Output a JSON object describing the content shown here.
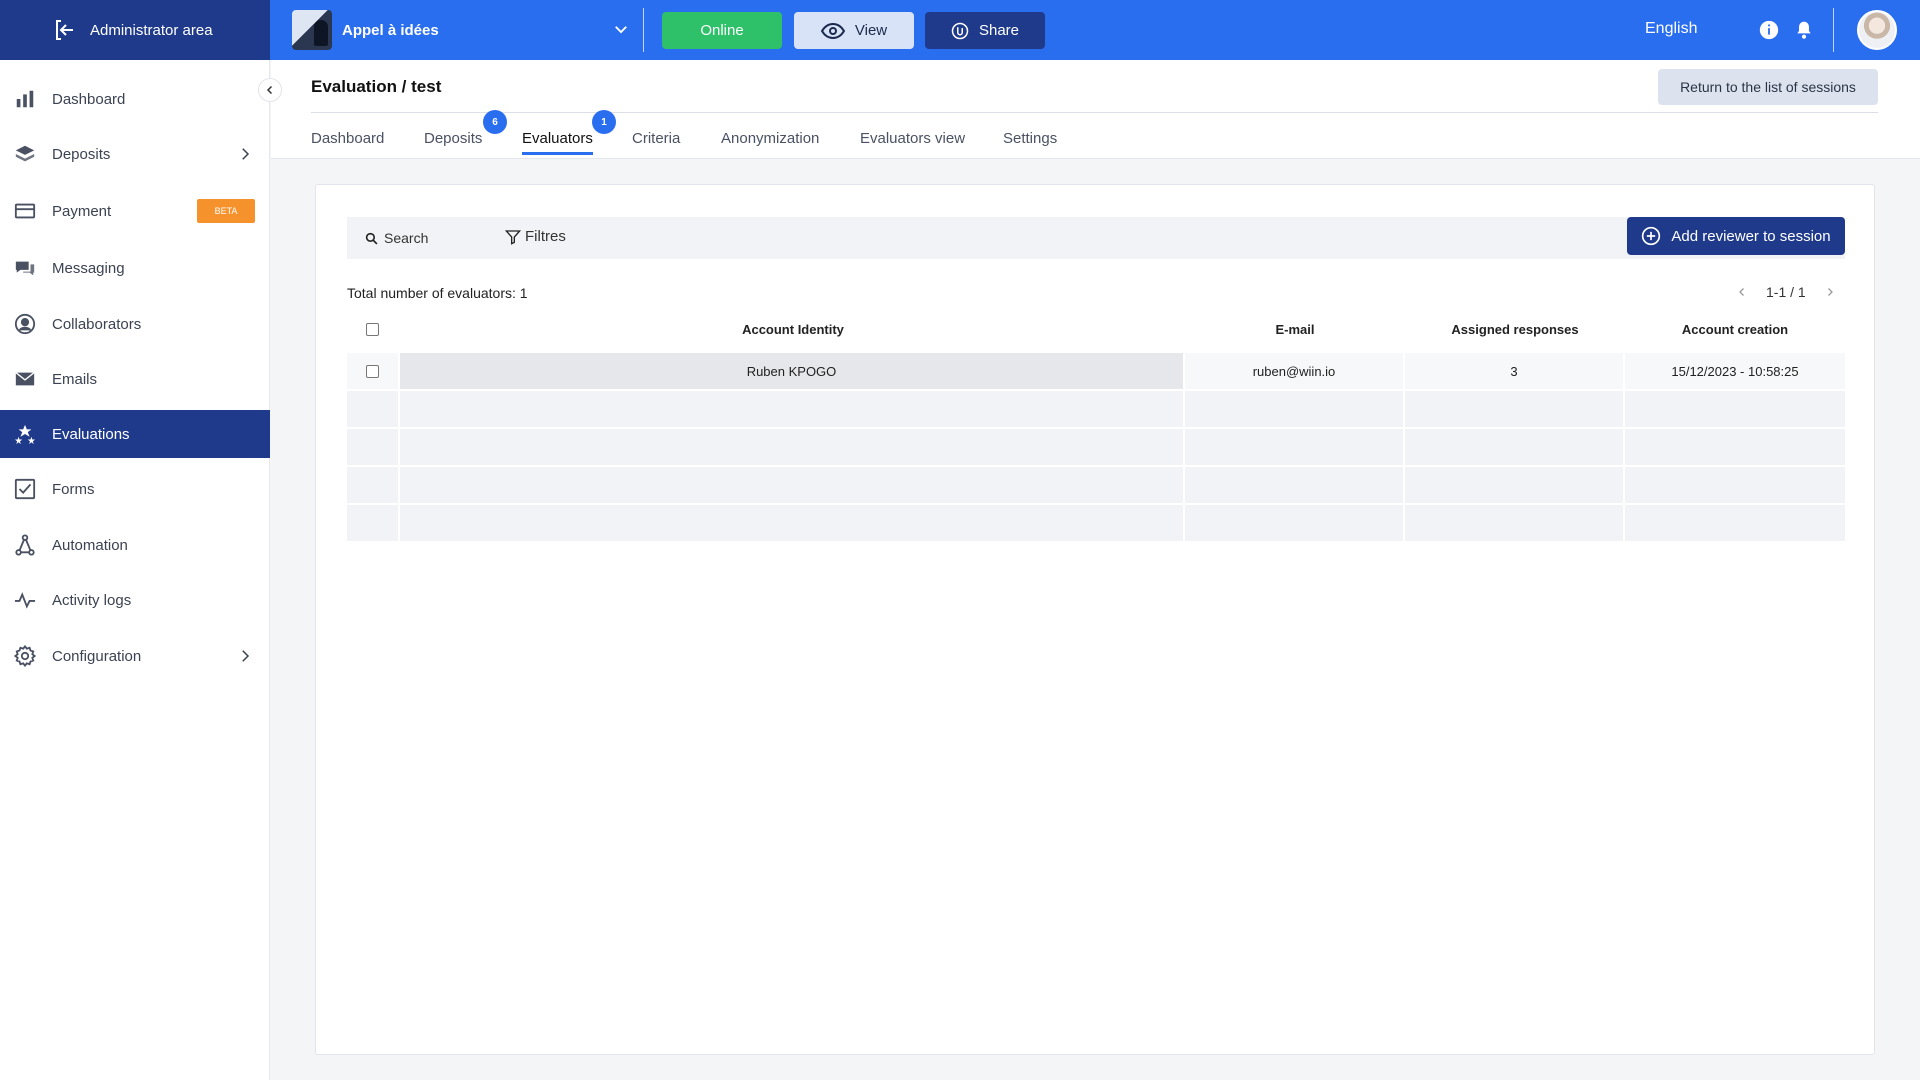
{
  "topbar": {
    "admin_label": "Administrator area",
    "project_name": "Appel à idées",
    "online_label": "Online",
    "view_label": "View",
    "share_label": "Share",
    "language": "English",
    "accent_color": "#2a6ef0",
    "dark_color": "#1f3a8a",
    "online_color": "#2ec16a"
  },
  "sidebar": {
    "items": [
      {
        "label": "Dashboard",
        "icon": "bar-chart-icon"
      },
      {
        "label": "Deposits",
        "icon": "layers-icon",
        "has_arrow": true
      },
      {
        "label": "Payment",
        "icon": "card-icon",
        "badge": "BETA"
      },
      {
        "label": "Messaging",
        "icon": "chat-icon"
      },
      {
        "label": "Collaborators",
        "icon": "user-circle-icon"
      },
      {
        "label": "Emails",
        "icon": "envelope-icon"
      },
      {
        "label": "Evaluations",
        "icon": "stars-icon",
        "active": true
      },
      {
        "label": "Forms",
        "icon": "checkbox-icon"
      },
      {
        "label": "Automation",
        "icon": "automation-icon"
      },
      {
        "label": "Activity logs",
        "icon": "pulse-icon"
      },
      {
        "label": "Configuration",
        "icon": "gear-icon",
        "has_arrow": true
      }
    ]
  },
  "header": {
    "title": "Evaluation / test",
    "return_label": "Return to the list of sessions",
    "tabs": [
      {
        "label": "Dashboard"
      },
      {
        "label": "Deposits",
        "badge": "6"
      },
      {
        "label": "Evaluators",
        "badge": "1",
        "active": true
      },
      {
        "label": "Criteria"
      },
      {
        "label": "Anonymization"
      },
      {
        "label": "Evaluators view"
      },
      {
        "label": "Settings"
      }
    ]
  },
  "toolbar": {
    "search_label": "Search",
    "filters_label": "Filtres",
    "add_label": "Add reviewer to session"
  },
  "table": {
    "total_label": "Total number of evaluators: 1",
    "pager": "1-1 / 1",
    "columns": [
      "Account Identity",
      "E-mail",
      "Assigned responses",
      "Account creation"
    ],
    "rows": [
      {
        "name": "Ruben KPOGO",
        "email": "ruben@wiin.io",
        "assigned": "3",
        "created": "15/12/2023 - 10:58:25"
      }
    ]
  }
}
